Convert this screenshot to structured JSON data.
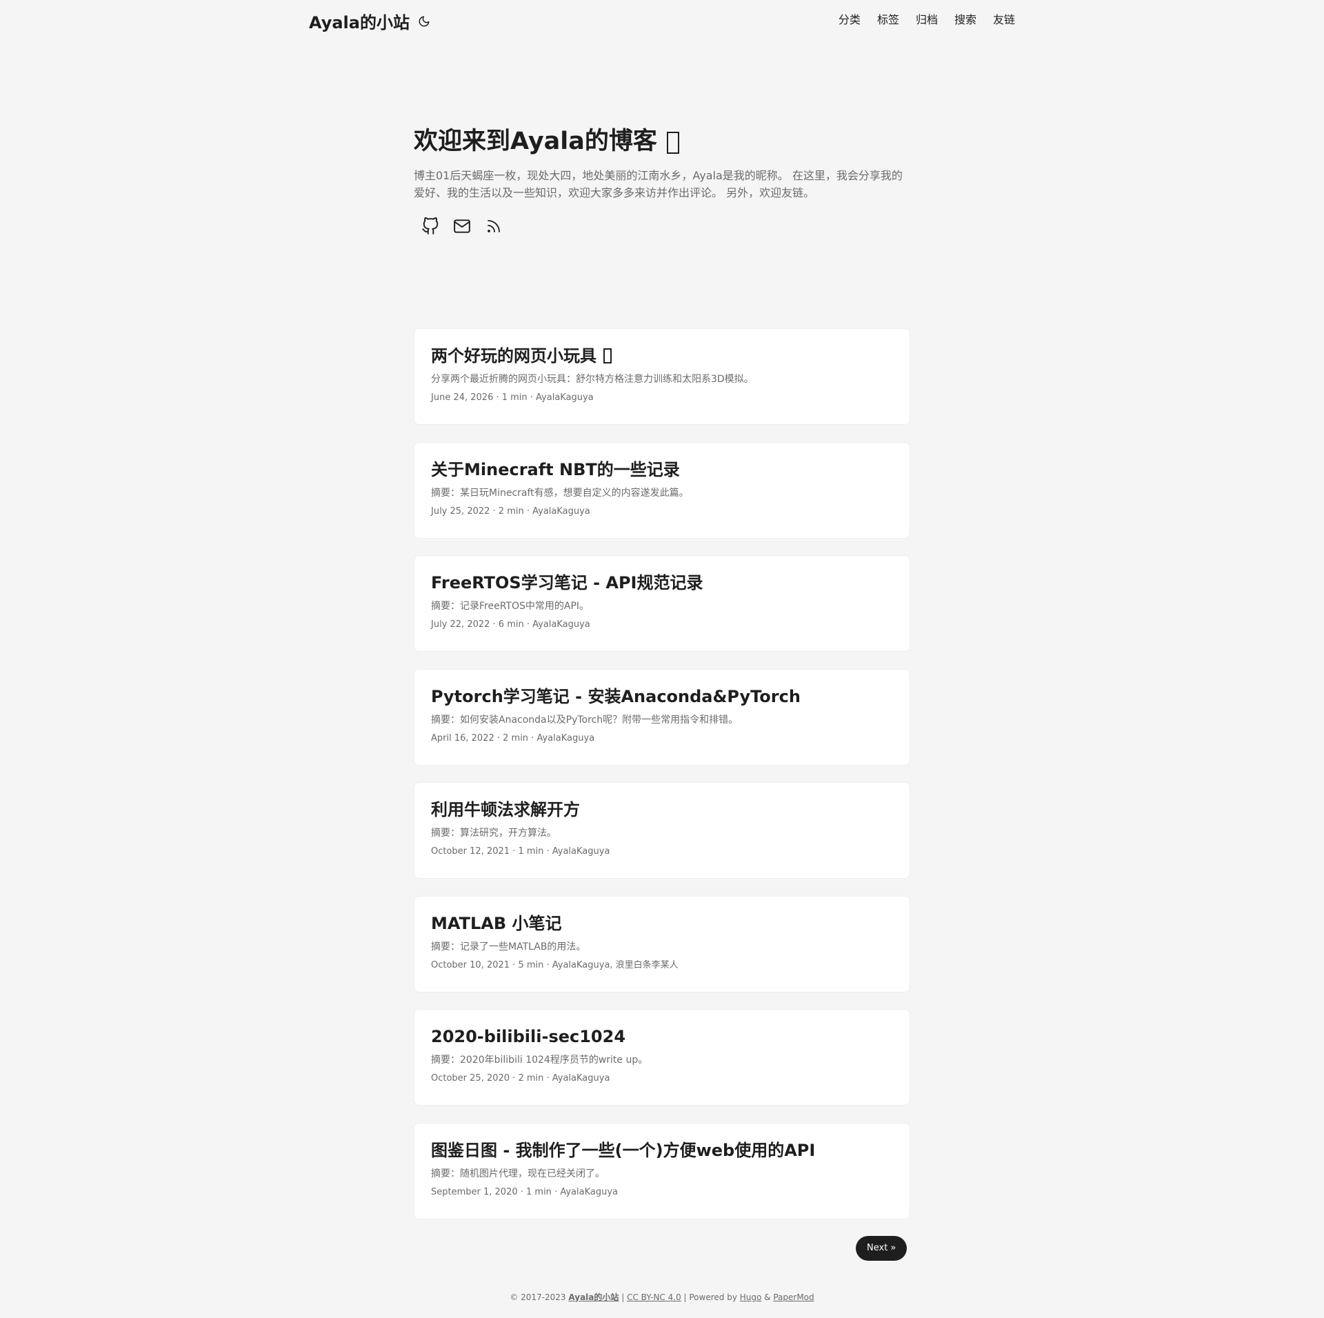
{
  "header": {
    "logo": "Ayala的小站",
    "theme_icon": "moon-icon",
    "nav": [
      "分类",
      "标签",
      "归档",
      "搜索",
      "友链"
    ]
  },
  "home": {
    "title": "欢迎来到Ayala的博客",
    "description": "博主01后天蝎座一枚，现处大四，地处美丽的江南水乡，Ayala是我的昵称。 在这里，我会分享我的爱好、我的生活以及一些知识，欢迎大家多多来访并作出评论。 另外，欢迎友链。",
    "social_icons": [
      "github-icon",
      "mail-icon",
      "rss-icon"
    ]
  },
  "posts": [
    {
      "title": "两个好玩的网页小玩具",
      "summary": "分享两个最近折腾的网页小玩具：舒尔特方格注意力训练和太阳系3D模拟。",
      "meta": "June 24, 2026 · 1 min · AyalaKaguya",
      "has_glyph": true
    },
    {
      "title": "关于Minecraft NBT的一些记录",
      "summary": "摘要：某日玩Minecraft有感，想要自定义的内容遂发此篇。",
      "meta": "July 25, 2022 · 2 min · AyalaKaguya"
    },
    {
      "title": "FreeRTOS学习笔记 - API规范记录",
      "summary": "摘要：记录FreeRTOS中常用的API。",
      "meta": "July 22, 2022 · 6 min · AyalaKaguya"
    },
    {
      "title": "Pytorch学习笔记 - 安装Anaconda&PyTorch",
      "summary": "摘要：如何安装Anaconda以及PyTorch呢？附带一些常用指令和排错。",
      "meta": "April 16, 2022 · 2 min · AyalaKaguya"
    },
    {
      "title": "利用牛顿法求解开方",
      "summary": "摘要：算法研究，开方算法。",
      "meta": "October 12, 2021 · 1 min · AyalaKaguya"
    },
    {
      "title": "MATLAB 小笔记",
      "summary": "摘要：记录了一些MATLAB的用法。",
      "meta": "October 10, 2021 · 5 min · AyalaKaguya, 浪里白条李某人"
    },
    {
      "title": "2020-bilibili-sec1024",
      "summary": "摘要：2020年bilibili 1024程序员节的write up。",
      "meta": "October 25, 2020 · 2 min · AyalaKaguya"
    },
    {
      "title": "图鉴日图 - 我制作了一些(一个)方便web使用的API",
      "summary": "摘要：随机图片代理，现在已经关闭了。",
      "meta": "September 1, 2020 · 1 min · AyalaKaguya"
    }
  ],
  "pagination": {
    "next_label": "Next  »"
  },
  "footer": {
    "copyright": "© 2017-2023 ",
    "site": "Ayala的小站",
    "sep1": " | ",
    "license": "CC BY-NC 4.0",
    "sep2": " |  Powered by ",
    "hugo": "Hugo",
    "amp": " & ",
    "theme": "PaperMod"
  }
}
